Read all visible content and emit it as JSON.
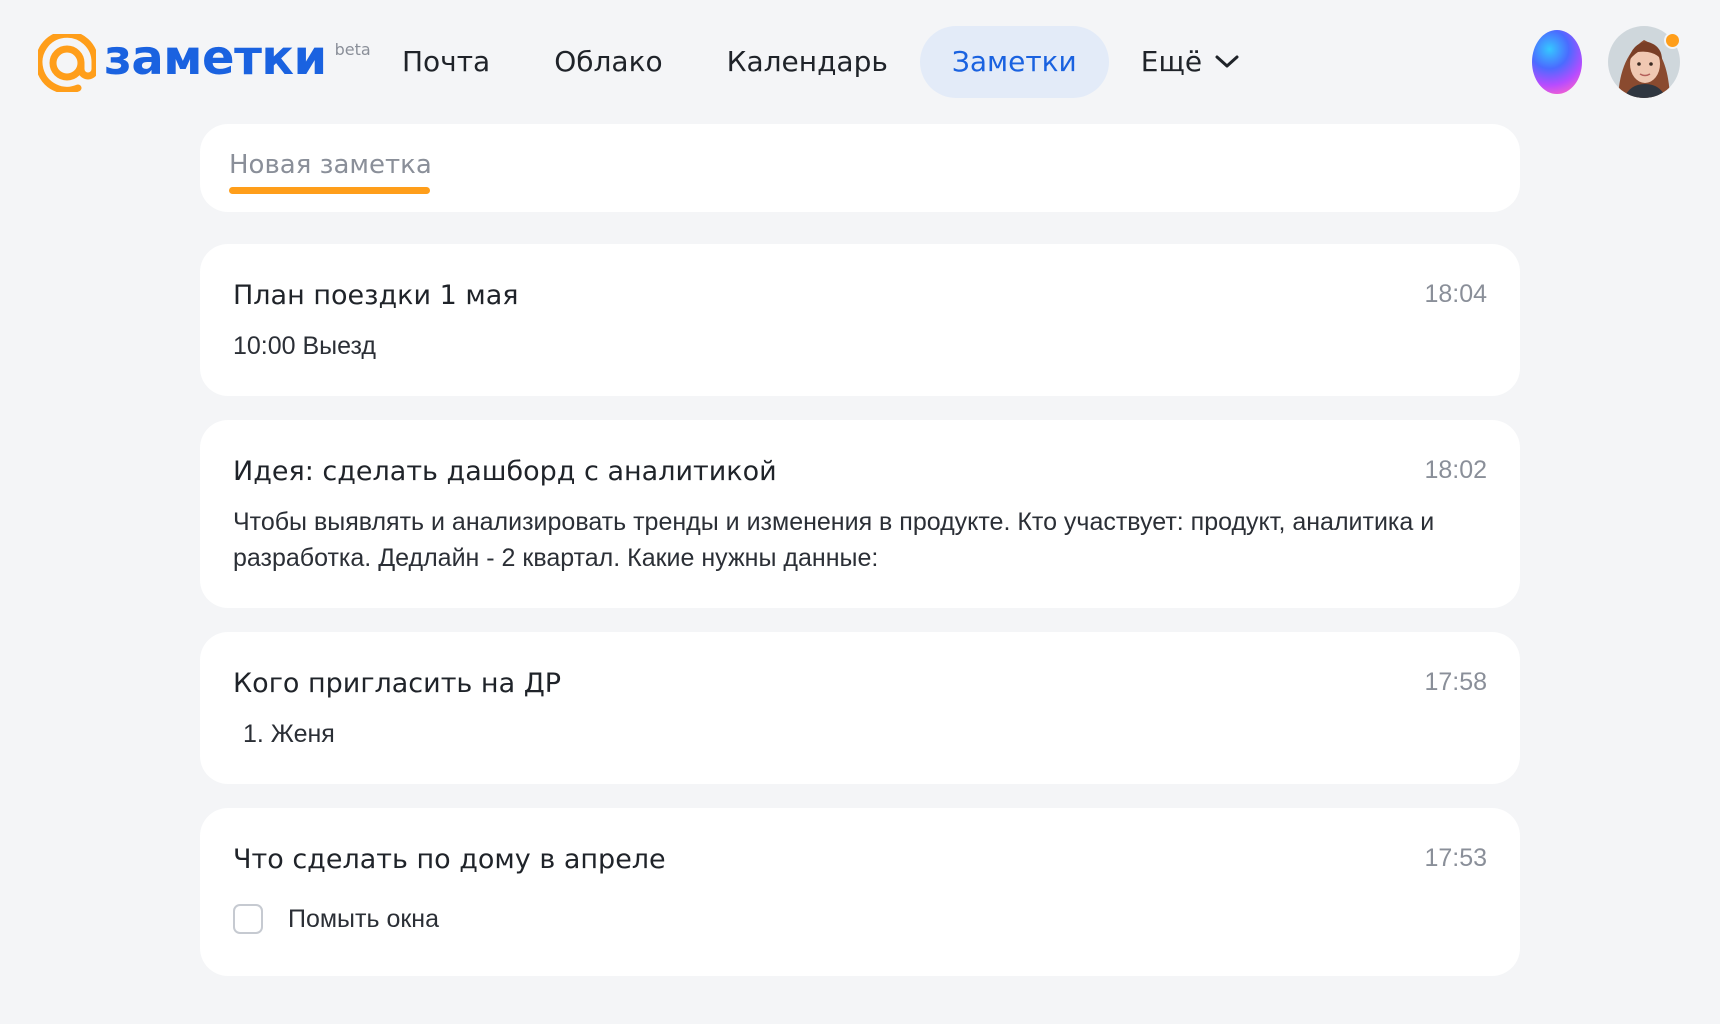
{
  "header": {
    "logo_text": "заметки",
    "logo_badge": "beta",
    "nav": [
      {
        "label": "Почта"
      },
      {
        "label": "Облако"
      },
      {
        "label": "Календарь"
      },
      {
        "label": "Заметки",
        "active": true
      },
      {
        "label": "Ещё"
      }
    ],
    "icons": {
      "logo": "at-sign-logo-icon",
      "more": "chevron-down-icon",
      "assistant": "voice-assistant-orb-icon",
      "avatar": "user-avatar",
      "notification": "notification-dot"
    }
  },
  "new_note": {
    "placeholder": "Новая заметка"
  },
  "notes": [
    {
      "title": "План поездки 1 мая",
      "time": "18:04",
      "body": "10:00 Выезд"
    },
    {
      "title": "Идея: сделать дашборд с аналитикой",
      "time": "18:02",
      "body": "Чтобы выявлять и анализировать тренды и изменения в продукте. Кто участвует: продукт, аналитика и разработка. Дедлайн - 2 квартал. Какие нужны данные:"
    },
    {
      "title": "Кого пригласить на ДР",
      "time": "17:58",
      "body": "1. Женя"
    },
    {
      "title": "Что сделать по дому в апреле",
      "time": "17:53",
      "checklist": [
        {
          "label": "Помыть окна",
          "checked": false
        }
      ]
    }
  ],
  "colors": {
    "accent_blue": "#1a62e0",
    "accent_orange": "#ff9e1a",
    "active_tab_bg": "#e3ebf8",
    "page_bg": "#f4f5f7",
    "card_bg": "#ffffff"
  }
}
